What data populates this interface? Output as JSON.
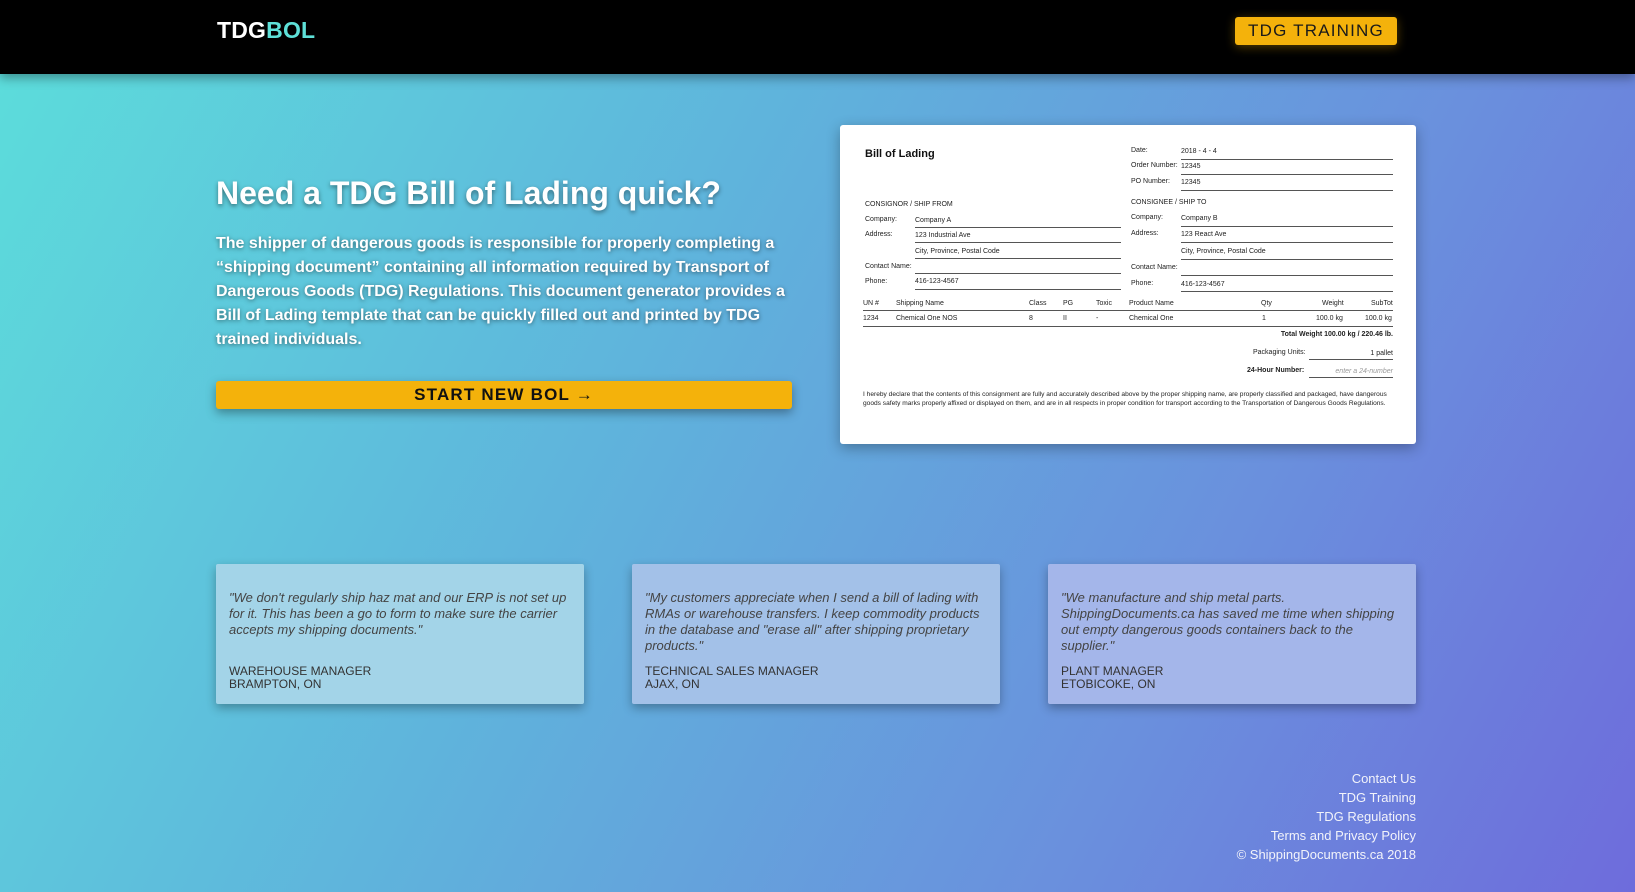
{
  "header": {
    "brand_part1": "TDG",
    "brand_part2": "BOL",
    "training_button": "TDG TRAINING"
  },
  "hero": {
    "title": "Need a TDG Bill of Lading quick?",
    "description": "The shipper of dangerous goods is responsible for properly completing a “shipping document” containing all information required by Transport of Dangerous Goods (TDG) Regulations. This document generator provides a Bill of Lading template that can be quickly filled out and printed by TDG trained individuals.",
    "start_button": "START NEW BOL →"
  },
  "preview": {
    "title": "Bill of Lading",
    "date_label": "Date:",
    "date_value": "2018 - 4 - 4",
    "order_label": "Order Number:",
    "order_value": "12345",
    "po_label": "PO Number:",
    "po_value": "12345",
    "consignor_heading": "CONSIGNOR / SHIP FROM",
    "consignee_heading": "CONSIGNEE / SHIP TO",
    "company_label": "Company:",
    "address_label": "Address:",
    "contact_label": "Contact Name:",
    "phone_label": "Phone:",
    "consignor": {
      "company": "Company A",
      "address": "123 Industrial Ave",
      "city": "City, Province, Postal Code",
      "phone": "416-123-4567"
    },
    "consignee": {
      "company": "Company B",
      "address": "123 React Ave",
      "city": "City, Province, Postal Code",
      "phone": "416-123-4567"
    },
    "columns": [
      "UN #",
      "Shipping Name",
      "Class",
      "PG",
      "Toxic",
      "Product Name",
      "Qty",
      "Weight",
      "SubTot"
    ],
    "row": [
      "1234",
      "Chemical One NOS",
      "8",
      "II",
      "-",
      "Chemical One",
      "1",
      "100.0 kg",
      "100.0 kg"
    ],
    "total_weight": "Total Weight 100.00 kg / 220.46 lb.",
    "packaging_label": "Packaging Units:",
    "packaging_value": "1 pallet",
    "hour_label": "24-Hour Number:",
    "hour_placeholder": "enter a 24-number",
    "declaration": "I hereby declare that the contents of this consignment are fully and accurately described above by the proper shipping name, are properly classified and packaged, have dangerous goods safety marks properly affixed or displayed on them, and are in all respects in proper condition for transport according to the Transportation of Dangerous Goods Regulations."
  },
  "testimonials": [
    {
      "quote": "\"We don't regularly ship haz mat and our ERP is not set up for it. This has been a go to form to make sure the carrier accepts my shipping documents.\"",
      "role": "Warehouse Manager",
      "location": "Brampton, ON"
    },
    {
      "quote": "\"My customers appreciate when I send a bill of lading with RMAs or warehouse transfers. I keep commodity products in the database and \"erase all\" after shipping proprietary products.\"",
      "role": "Technical Sales Manager",
      "location": "Ajax, ON"
    },
    {
      "quote": "\"We manufacture and ship metal parts. ShippingDocuments.ca has saved me time when shipping out empty dangerous goods containers back to the supplier.\"",
      "role": "Plant Manager",
      "location": "Etobicoke, ON"
    }
  ],
  "footer": {
    "links": [
      "Contact Us",
      "TDG Training",
      "TDG Regulations",
      "Terms and Privacy Policy"
    ],
    "copyright": "© ShippingDocuments.ca 2018"
  },
  "colors": {
    "accent": "#f4b20b",
    "brand_highlight": "#5ee0d8",
    "header_bg": "#000000"
  }
}
